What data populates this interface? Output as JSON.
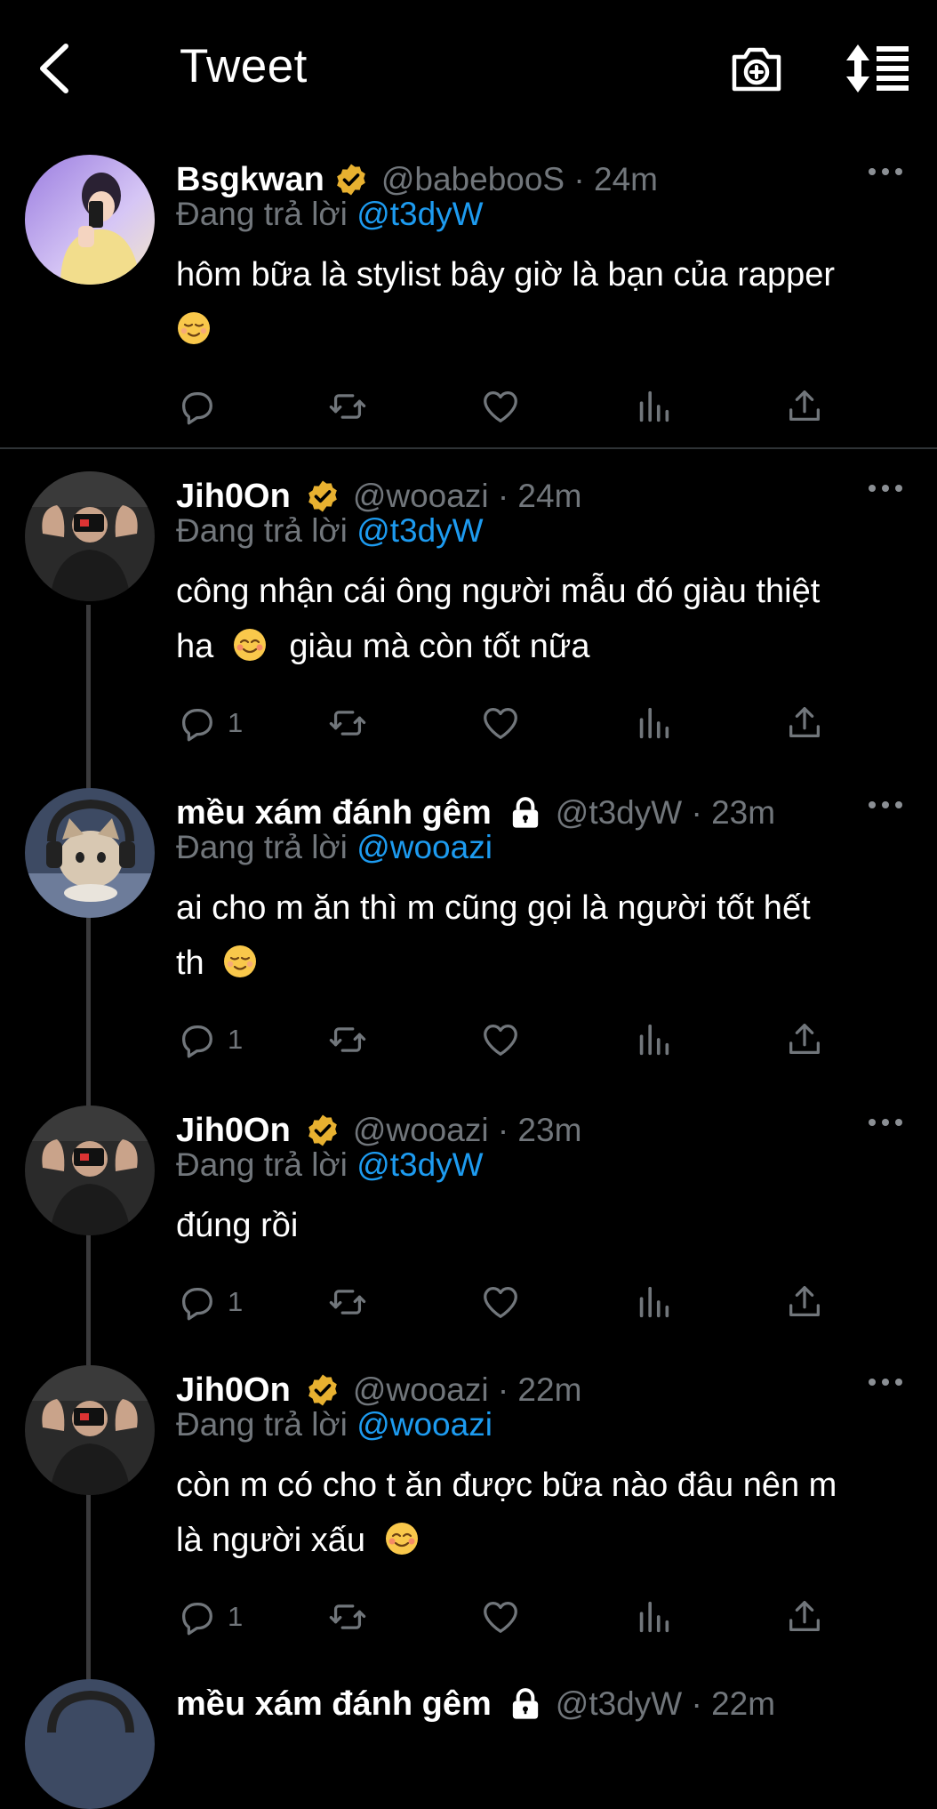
{
  "header": {
    "title": "Tweet",
    "back_icon": "chevron-left-icon",
    "camera_icon": "camera-plus-icon",
    "sort_icon": "sort-list-icon"
  },
  "tweets": [
    {
      "name": "Bsgkwan",
      "handle": "@babebooS · 24m",
      "reply_prefix": "Đang trả lời",
      "reply_to": "@t3dyW",
      "text": "hôm bữa là stylist bây giờ là bạn của rapper",
      "reply_count": ""
    },
    {
      "name": "Jih0On",
      "handle": "@wooazi · 24m",
      "reply_prefix": "Đang trả lời",
      "reply_to": "@t3dyW",
      "text_1": "công nhận cái ông người mẫu đó giàu thiệt",
      "text_2a": "ha",
      "text_2b": "giàu mà còn tốt nữa",
      "reply_count": "1"
    },
    {
      "name": "mều xám đánh gêm",
      "handle": "@t3dyW · 23m",
      "reply_prefix": "Đang trả lời",
      "reply_to": "@wooazi",
      "text_1": "ai cho m ăn thì m cũng gọi là người tốt hết",
      "text_2": "th",
      "reply_count": "1"
    },
    {
      "name": "Jih0On",
      "handle": "@wooazi · 23m",
      "reply_prefix": "Đang trả lời",
      "reply_to": "@t3dyW",
      "text": "đúng rồi",
      "reply_count": "1"
    },
    {
      "name": "Jih0On",
      "handle": "@wooazi · 22m",
      "reply_prefix": "Đang trả lời",
      "reply_to": "@wooazi",
      "text_1": "còn m có cho t ăn được bữa nào đâu nên m",
      "text_2": "là người xấu",
      "reply_count": "1"
    },
    {
      "name": "mều xám đánh gêm",
      "handle": "@t3dyW · 22m"
    }
  ],
  "colors": {
    "link": "#1d9bf0",
    "muted": "#71767b",
    "verified": "#e8b130"
  }
}
